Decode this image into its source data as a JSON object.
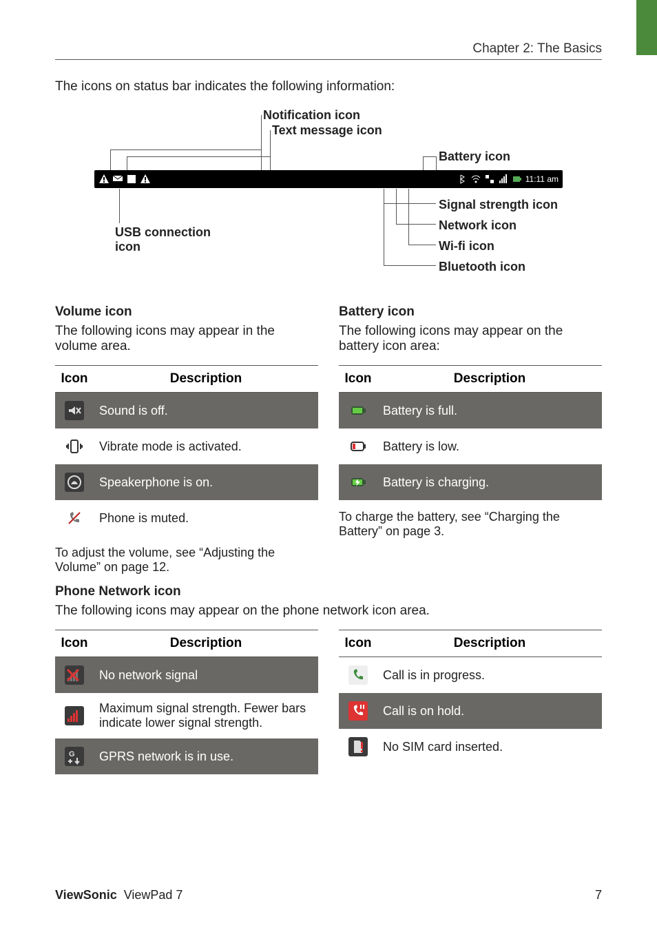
{
  "header": {
    "chapter": "Chapter 2: The Basics"
  },
  "intro": "The icons on status bar indicates the following information:",
  "diagram": {
    "notification": "Notification icon",
    "text_msg": "Text message icon",
    "battery": "Battery icon",
    "usb": "USB connection icon",
    "signal": "Signal strength icon",
    "network": "Network icon",
    "wifi": "Wi-fi icon",
    "bluetooth": "Bluetooth icon",
    "time": "11:11 am"
  },
  "volume": {
    "heading": "Volume icon",
    "desc": "The following icons may appear in the volume area.",
    "th_icon": "Icon",
    "th_desc": "Description",
    "rows": [
      {
        "desc": "Sound is off.",
        "name": "sound-off-icon",
        "bg": "#3a3a3a"
      },
      {
        "desc": "Vibrate mode is activated.",
        "name": "vibrate-icon",
        "bg": ""
      },
      {
        "desc": "Speakerphone is on.",
        "name": "speakerphone-icon",
        "bg": "#3a3a3a"
      },
      {
        "desc": "Phone is muted.",
        "name": "phone-muted-icon",
        "bg": ""
      }
    ],
    "note": "To adjust the volume, see “Adjusting the Volume” on page 12."
  },
  "battery": {
    "heading": "Battery icon",
    "desc": "The following icons may appear on the battery icon area:",
    "th_icon": "Icon",
    "th_desc": "Description",
    "rows": [
      {
        "desc": "Battery is full.",
        "name": "battery-full-icon"
      },
      {
        "desc": "Battery is low.",
        "name": "battery-low-icon"
      },
      {
        "desc": "Battery is charging.",
        "name": "battery-charging-icon"
      }
    ],
    "note": "To charge the battery, see “Charging the Battery” on page 3."
  },
  "network": {
    "heading": "Phone Network icon",
    "desc": "The following icons may appear on the phone network icon area.",
    "th_icon": "Icon",
    "th_desc": "Description",
    "left_rows": [
      {
        "desc": "No network signal",
        "name": "no-signal-icon"
      },
      {
        "desc": "Maximum signal strength. Fewer bars indicate lower signal strength.",
        "name": "signal-bars-icon"
      },
      {
        "desc": "GPRS network is in use.",
        "name": "gprs-icon"
      }
    ],
    "right_rows": [
      {
        "desc": "Call is in progress.",
        "name": "call-progress-icon"
      },
      {
        "desc": "Call is on hold.",
        "name": "call-hold-icon"
      },
      {
        "desc": "No SIM card inserted.",
        "name": "no-sim-icon"
      }
    ]
  },
  "footer": {
    "brand_bold": "ViewSonic",
    "brand_rest": "ViewPad 7",
    "page": "7"
  }
}
